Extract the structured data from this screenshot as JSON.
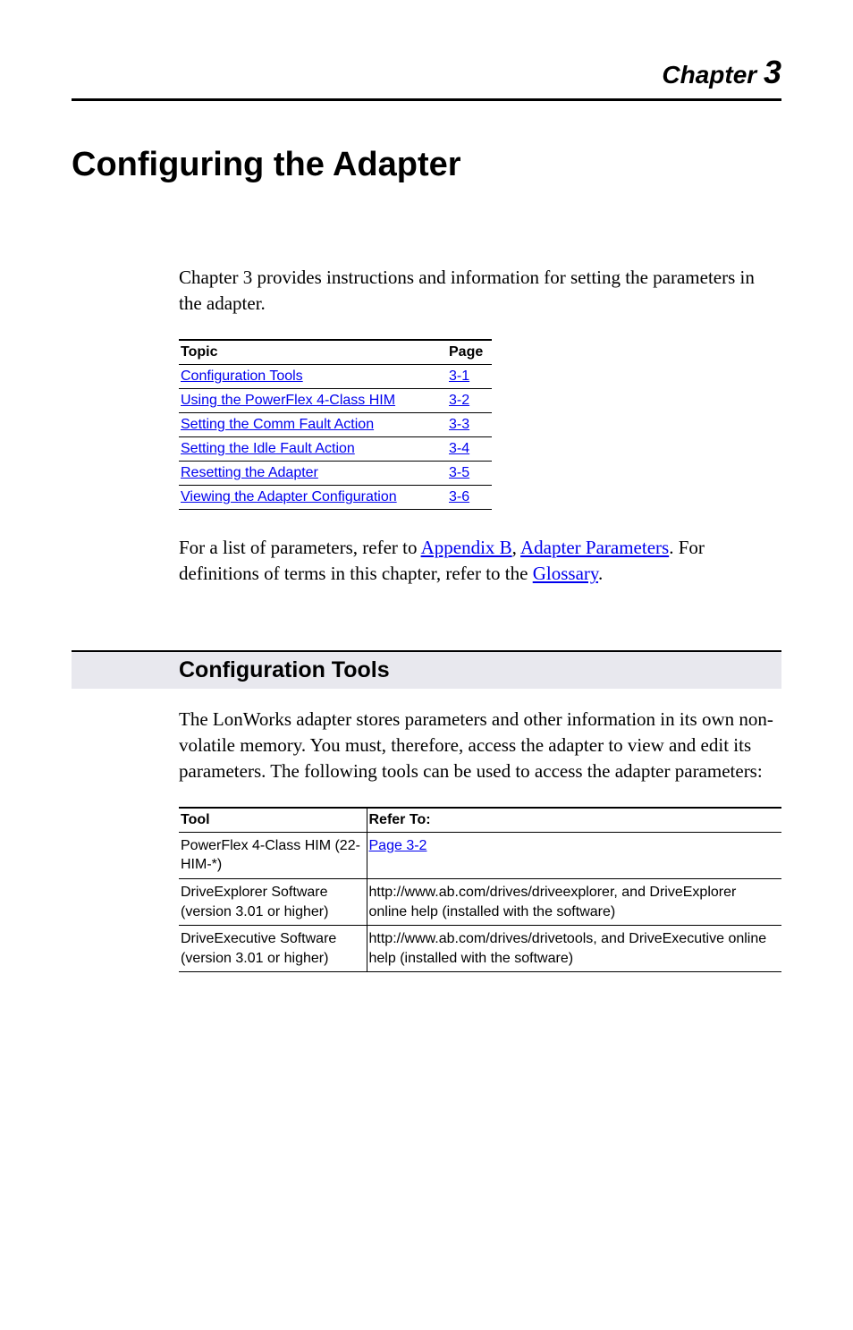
{
  "chapter": {
    "label": "Chapter",
    "number": "3"
  },
  "title": "Configuring the Adapter",
  "intro": "Chapter 3 provides instructions and information for setting the parameters in the adapter.",
  "topic_table": {
    "headers": [
      "Topic",
      "Page"
    ],
    "rows": [
      {
        "topic": "Configuration Tools",
        "page": "3-1"
      },
      {
        "topic": "Using the PowerFlex 4-Class HIM",
        "page": "3-2"
      },
      {
        "topic": "Setting the Comm Fault Action",
        "page": "3-3"
      },
      {
        "topic": "Setting the Idle Fault Action",
        "page": "3-4"
      },
      {
        "topic": "Resetting the Adapter",
        "page": "3-5"
      },
      {
        "topic": "Viewing the Adapter Configuration",
        "page": "3-6"
      }
    ]
  },
  "followup": {
    "pre1": "For a list of parameters, refer to ",
    "link1": "Appendix B",
    "sep1": ", ",
    "link2": "Adapter Parameters",
    "post1": ". For definitions of terms in this chapter, refer to the ",
    "link3": "Glossary",
    "post2": "."
  },
  "section": {
    "heading": "Configuration Tools",
    "body": "The LonWorks adapter stores parameters and other information in its own non-volatile memory. You must, therefore, access the adapter to view and edit its parameters. The following tools can be used to access the adapter parameters:"
  },
  "tool_table": {
    "headers": [
      "Tool",
      "Refer To:"
    ],
    "rows": [
      {
        "tool": "PowerFlex 4-Class HIM (22-HIM-*)",
        "refer_link": "Page 3-2",
        "refer_rest": ""
      },
      {
        "tool": "DriveExplorer Software (version 3.01 or higher)",
        "refer_link": "",
        "refer_rest": "http://www.ab.com/drives/driveexplorer, and DriveExplorer online help (installed with the software)"
      },
      {
        "tool": "DriveExecutive Software (version 3.01 or higher)",
        "refer_link": "",
        "refer_rest": "http://www.ab.com/drives/drivetools, and DriveExecutive online help (installed with the software)"
      }
    ]
  }
}
